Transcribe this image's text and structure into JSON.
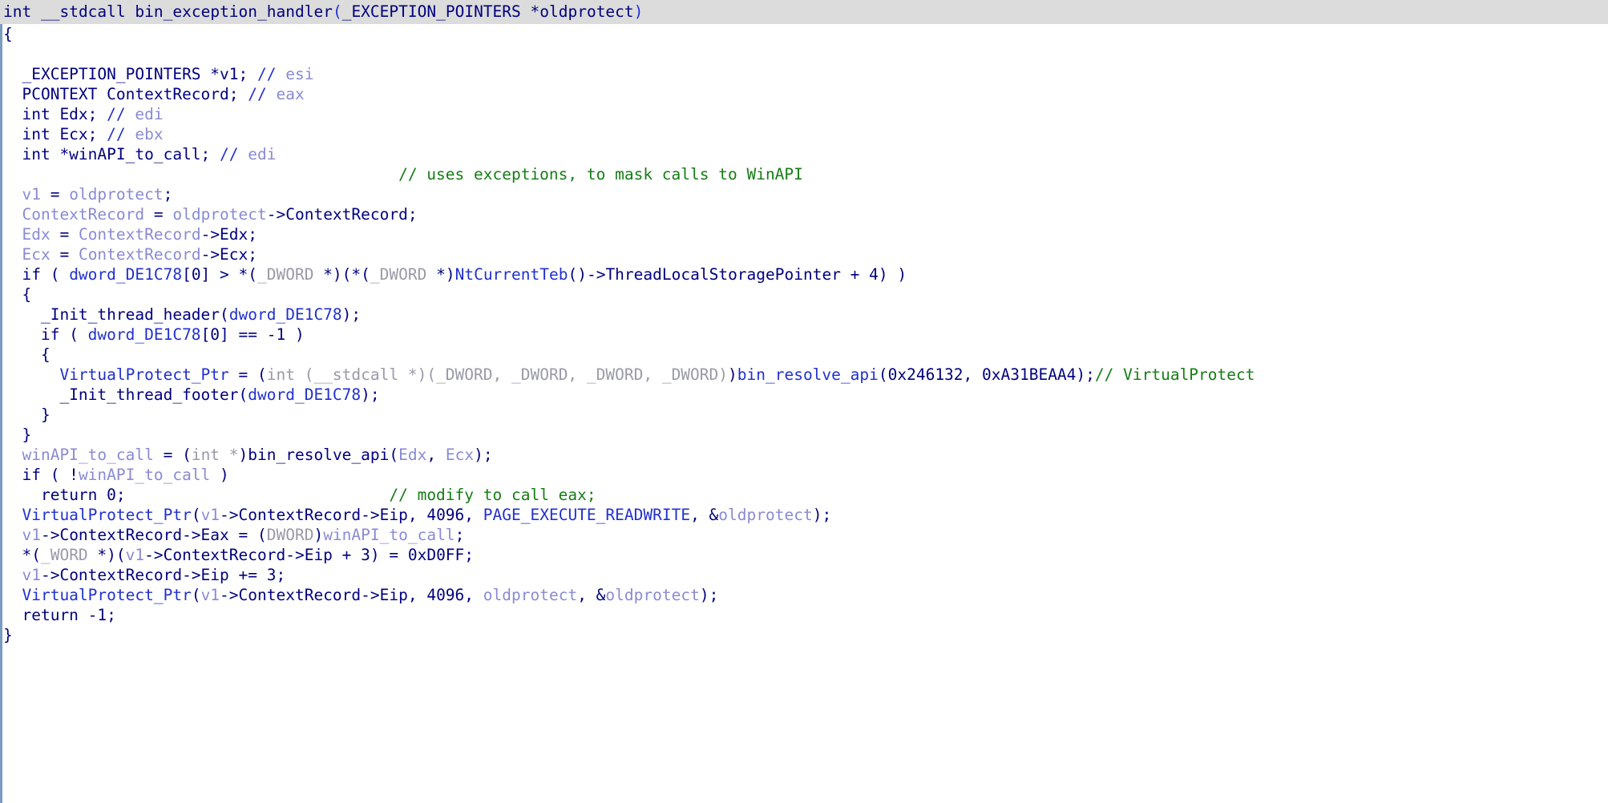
{
  "app": {
    "view_name": "pseudocode-view",
    "kind": "decompiler-pseudocode"
  },
  "colors": {
    "header_background": "#dcdcdc",
    "header_text": "#808080",
    "default_code": "#00007f",
    "local_variable": "#8a8ad4",
    "global_symbol": "#2030cf",
    "cast_type": "#9a9aa8",
    "comment": "#157d15",
    "gutter_rule": "#7b9bbf",
    "background": "#ffffff"
  },
  "header": {
    "return_type": "int",
    "calling_convention": "__stdcall",
    "function_name": "bin_exception_handler",
    "open_paren": "(",
    "param_type": "_EXCEPTION_POINTERS",
    "param_star": " *",
    "param_name": "oldprotect",
    "close_paren": ")"
  },
  "lines": [
    {
      "n": 1,
      "indent": 0,
      "tokens": [
        {
          "t": "{",
          "c": "def"
        }
      ]
    },
    {
      "n": 2,
      "indent": 0,
      "tokens": []
    },
    {
      "n": 3,
      "indent": 1,
      "tokens": [
        {
          "t": "_EXCEPTION_POINTERS *v1; ",
          "c": "def"
        },
        {
          "t": "// ",
          "c": "cmtm"
        },
        {
          "t": "esi",
          "c": "lvar"
        }
      ]
    },
    {
      "n": 4,
      "indent": 1,
      "tokens": [
        {
          "t": "PCONTEXT ContextRecord; ",
          "c": "def"
        },
        {
          "t": "// ",
          "c": "cmtm"
        },
        {
          "t": "eax",
          "c": "lvar"
        }
      ]
    },
    {
      "n": 5,
      "indent": 1,
      "tokens": [
        {
          "t": "int Edx; ",
          "c": "def"
        },
        {
          "t": "// ",
          "c": "cmtm"
        },
        {
          "t": "edi",
          "c": "lvar"
        }
      ]
    },
    {
      "n": 6,
      "indent": 1,
      "tokens": [
        {
          "t": "int Ecx; ",
          "c": "def"
        },
        {
          "t": "// ",
          "c": "cmtm"
        },
        {
          "t": "ebx",
          "c": "lvar"
        }
      ]
    },
    {
      "n": 7,
      "indent": 1,
      "tokens": [
        {
          "t": "int *winAPI_to_call; ",
          "c": "def"
        },
        {
          "t": "// ",
          "c": "cmtm"
        },
        {
          "t": "edi",
          "c": "lvar"
        }
      ]
    },
    {
      "n": 8,
      "indent": 0,
      "tokens": [
        {
          "t": "                                          // uses exceptions, to mask calls to WinAPI",
          "c": "cmt"
        }
      ]
    },
    {
      "n": 9,
      "indent": 1,
      "tokens": [
        {
          "t": "v1",
          "c": "lvar"
        },
        {
          "t": " = ",
          "c": "def"
        },
        {
          "t": "oldprotect",
          "c": "lvar"
        },
        {
          "t": ";",
          "c": "def"
        }
      ]
    },
    {
      "n": 10,
      "indent": 1,
      "tokens": [
        {
          "t": "ContextRecord",
          "c": "lvar"
        },
        {
          "t": " = ",
          "c": "def"
        },
        {
          "t": "oldprotect",
          "c": "lvar"
        },
        {
          "t": "->ContextRecord;",
          "c": "def"
        }
      ]
    },
    {
      "n": 11,
      "indent": 1,
      "tokens": [
        {
          "t": "Edx",
          "c": "lvar"
        },
        {
          "t": " = ",
          "c": "def"
        },
        {
          "t": "ContextRecord",
          "c": "lvar"
        },
        {
          "t": "->Edx;",
          "c": "def"
        }
      ]
    },
    {
      "n": 12,
      "indent": 1,
      "tokens": [
        {
          "t": "Ecx",
          "c": "lvar"
        },
        {
          "t": " = ",
          "c": "def"
        },
        {
          "t": "ContextRecord",
          "c": "lvar"
        },
        {
          "t": "->Ecx;",
          "c": "def"
        }
      ]
    },
    {
      "n": 13,
      "indent": 1,
      "tokens": [
        {
          "t": "if ( ",
          "c": "def"
        },
        {
          "t": "dword_DE1C78",
          "c": "glob"
        },
        {
          "t": "[0] > *(",
          "c": "def"
        },
        {
          "t": "_DWORD",
          "c": "type"
        },
        {
          "t": " *)(*(",
          "c": "def"
        },
        {
          "t": "_DWORD",
          "c": "type"
        },
        {
          "t": " *)",
          "c": "def"
        },
        {
          "t": "NtCurrentTeb",
          "c": "glob"
        },
        {
          "t": "()->ThreadLocalStoragePointer + 4) )",
          "c": "def"
        }
      ]
    },
    {
      "n": 14,
      "indent": 1,
      "tokens": [
        {
          "t": "{",
          "c": "def"
        }
      ]
    },
    {
      "n": 15,
      "indent": 2,
      "tokens": [
        {
          "t": "_Init_thread_header(",
          "c": "def"
        },
        {
          "t": "dword_DE1C78",
          "c": "glob"
        },
        {
          "t": ");",
          "c": "def"
        }
      ]
    },
    {
      "n": 16,
      "indent": 2,
      "tokens": [
        {
          "t": "if ( ",
          "c": "def"
        },
        {
          "t": "dword_DE1C78",
          "c": "glob"
        },
        {
          "t": "[0] == -1 )",
          "c": "def"
        }
      ]
    },
    {
      "n": 17,
      "indent": 2,
      "tokens": [
        {
          "t": "{",
          "c": "def"
        }
      ]
    },
    {
      "n": 18,
      "indent": 3,
      "tokens": [
        {
          "t": "VirtualProtect_Ptr",
          "c": "glob"
        },
        {
          "t": " = (",
          "c": "def"
        },
        {
          "t": "int (__stdcall *)(_DWORD, _DWORD, _DWORD, _DWORD)",
          "c": "type"
        },
        {
          "t": ")",
          "c": "def"
        },
        {
          "t": "bin_resolve_api",
          "c": "glob"
        },
        {
          "t": "(0x246132, 0xA31BEAA4);",
          "c": "def"
        },
        {
          "t": "// VirtualProtect",
          "c": "cmt"
        }
      ]
    },
    {
      "n": 19,
      "indent": 3,
      "tokens": [
        {
          "t": "_Init_thread_footer(",
          "c": "def"
        },
        {
          "t": "dword_DE1C78",
          "c": "glob"
        },
        {
          "t": ");",
          "c": "def"
        }
      ]
    },
    {
      "n": 20,
      "indent": 2,
      "tokens": [
        {
          "t": "}",
          "c": "def"
        }
      ]
    },
    {
      "n": 21,
      "indent": 1,
      "tokens": [
        {
          "t": "}",
          "c": "def"
        }
      ]
    },
    {
      "n": 22,
      "indent": 1,
      "tokens": [
        {
          "t": "winAPI_to_call",
          "c": "lvar"
        },
        {
          "t": " = (",
          "c": "def"
        },
        {
          "t": "int *",
          "c": "type"
        },
        {
          "t": ")",
          "c": "def"
        },
        {
          "t": "bin_resolve_api",
          "c": "def"
        },
        {
          "t": "(",
          "c": "def"
        },
        {
          "t": "Edx",
          "c": "lvar"
        },
        {
          "t": ", ",
          "c": "def"
        },
        {
          "t": "Ecx",
          "c": "lvar"
        },
        {
          "t": ");",
          "c": "def"
        }
      ]
    },
    {
      "n": 23,
      "indent": 1,
      "tokens": [
        {
          "t": "if ( !",
          "c": "def"
        },
        {
          "t": "winAPI_to_call",
          "c": "lvar"
        },
        {
          "t": " )",
          "c": "def"
        }
      ]
    },
    {
      "n": 24,
      "indent": 2,
      "tokens": [
        {
          "t": "return 0;",
          "c": "def"
        },
        {
          "t": "                            // modify to call eax;",
          "c": "cmt"
        }
      ]
    },
    {
      "n": 25,
      "indent": 1,
      "tokens": [
        {
          "t": "VirtualProtect_Ptr",
          "c": "glob"
        },
        {
          "t": "(",
          "c": "def"
        },
        {
          "t": "v1",
          "c": "lvar"
        },
        {
          "t": "->ContextRecord->Eip, 4096, ",
          "c": "def"
        },
        {
          "t": "PAGE_EXECUTE_READWRITE",
          "c": "enum"
        },
        {
          "t": ", &",
          "c": "def"
        },
        {
          "t": "oldprotect",
          "c": "lvar"
        },
        {
          "t": ");",
          "c": "def"
        }
      ]
    },
    {
      "n": 26,
      "indent": 1,
      "tokens": [
        {
          "t": "v1",
          "c": "lvar"
        },
        {
          "t": "->ContextRecord->Eax = (",
          "c": "def"
        },
        {
          "t": "DWORD",
          "c": "type"
        },
        {
          "t": ")",
          "c": "def"
        },
        {
          "t": "winAPI_to_call",
          "c": "lvar"
        },
        {
          "t": ";",
          "c": "def"
        }
      ]
    },
    {
      "n": 27,
      "indent": 1,
      "tokens": [
        {
          "t": "*(",
          "c": "def"
        },
        {
          "t": "_WORD",
          "c": "type"
        },
        {
          "t": " *)(",
          "c": "def"
        },
        {
          "t": "v1",
          "c": "lvar"
        },
        {
          "t": "->ContextRecord->Eip + 3) = 0xD0FF;",
          "c": "def"
        }
      ]
    },
    {
      "n": 28,
      "indent": 1,
      "tokens": [
        {
          "t": "v1",
          "c": "lvar"
        },
        {
          "t": "->ContextRecord->Eip += 3;",
          "c": "def"
        }
      ]
    },
    {
      "n": 29,
      "indent": 1,
      "tokens": [
        {
          "t": "VirtualProtect_Ptr",
          "c": "glob"
        },
        {
          "t": "(",
          "c": "def"
        },
        {
          "t": "v1",
          "c": "lvar"
        },
        {
          "t": "->ContextRecord->Eip, 4096, ",
          "c": "def"
        },
        {
          "t": "oldprotect",
          "c": "lvar"
        },
        {
          "t": ", &",
          "c": "def"
        },
        {
          "t": "oldprotect",
          "c": "lvar"
        },
        {
          "t": ");",
          "c": "def"
        }
      ]
    },
    {
      "n": 30,
      "indent": 1,
      "tokens": [
        {
          "t": "return -1;",
          "c": "def"
        }
      ]
    },
    {
      "n": 31,
      "indent": 0,
      "tokens": [
        {
          "t": "}",
          "c": "def"
        }
      ]
    }
  ]
}
